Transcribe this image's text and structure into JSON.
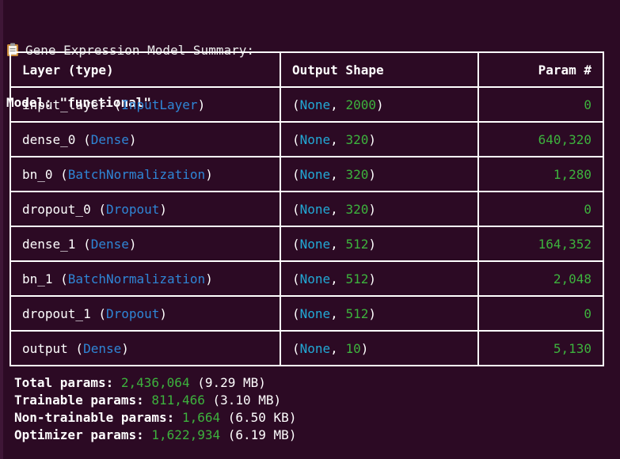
{
  "header": {
    "title": "Gene Expression Model Summary:",
    "model_label": "Model:",
    "model_name": "\"functional\""
  },
  "table": {
    "columns": [
      "Layer (type)",
      "Output Shape",
      "Param #"
    ],
    "rows": [
      {
        "name": "input_layer",
        "type": "InputLayer",
        "shape_none": "None",
        "shape_dim": "2000",
        "params": "0"
      },
      {
        "name": "dense_0",
        "type": "Dense",
        "shape_none": "None",
        "shape_dim": "320",
        "params": "640,320"
      },
      {
        "name": "bn_0",
        "type": "BatchNormalization",
        "shape_none": "None",
        "shape_dim": "320",
        "params": "1,280"
      },
      {
        "name": "dropout_0",
        "type": "Dropout",
        "shape_none": "None",
        "shape_dim": "320",
        "params": "0"
      },
      {
        "name": "dense_1",
        "type": "Dense",
        "shape_none": "None",
        "shape_dim": "512",
        "params": "164,352"
      },
      {
        "name": "bn_1",
        "type": "BatchNormalization",
        "shape_none": "None",
        "shape_dim": "512",
        "params": "2,048"
      },
      {
        "name": "dropout_1",
        "type": "Dropout",
        "shape_none": "None",
        "shape_dim": "512",
        "params": "0"
      },
      {
        "name": "output",
        "type": "Dense",
        "shape_none": "None",
        "shape_dim": "10",
        "params": "5,130"
      }
    ]
  },
  "totals": [
    {
      "label": "Total params:",
      "value": "2,436,064",
      "size": "(9.29 MB)"
    },
    {
      "label": "Trainable params:",
      "value": "811,466",
      "size": "(3.10 MB)"
    },
    {
      "label": "Non-trainable params:",
      "value": "1,664",
      "size": "(6.50 KB)"
    },
    {
      "label": "Optimizer params:",
      "value": "1,622,934",
      "size": "(6.19 MB)"
    }
  ],
  "colors": {
    "background": "#2c0a24",
    "type_blue": "#2f86d6",
    "none_cyan": "#22a9d6",
    "number_green": "#3db23d"
  },
  "icons": {
    "title_icon": "clipboard-icon"
  }
}
